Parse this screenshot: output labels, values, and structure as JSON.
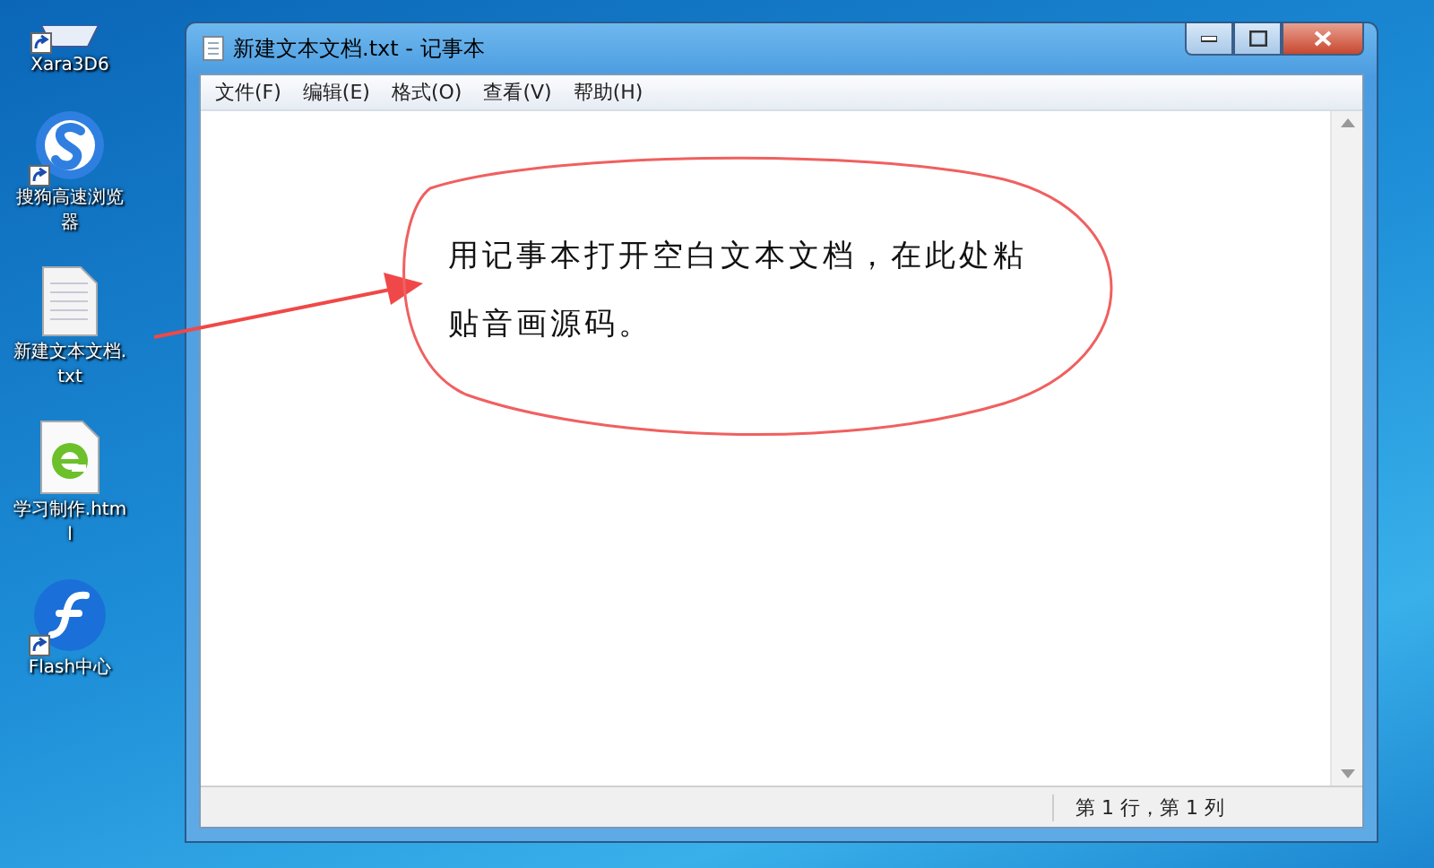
{
  "desktop_icons": [
    {
      "label": "Xara3D6",
      "kind": "xara",
      "shortcut": true
    },
    {
      "label": "搜狗高速浏览器",
      "kind": "browser",
      "shortcut": true
    },
    {
      "label": "新建文本文档.txt",
      "kind": "text",
      "shortcut": false
    },
    {
      "label": "学习制作.html",
      "kind": "html",
      "shortcut": false
    },
    {
      "label": "Flash中心",
      "kind": "flash",
      "shortcut": true
    }
  ],
  "window": {
    "title": "新建文本文档.txt - 记事本",
    "menu": [
      "文件(F)",
      "编辑(E)",
      "格式(O)",
      "查看(V)",
      "帮助(H)"
    ],
    "status_bar": "第 1 行，第 1 列"
  },
  "annotation": {
    "text": "用记事本打开空白文本文档，在此处粘贴音画源码。"
  }
}
